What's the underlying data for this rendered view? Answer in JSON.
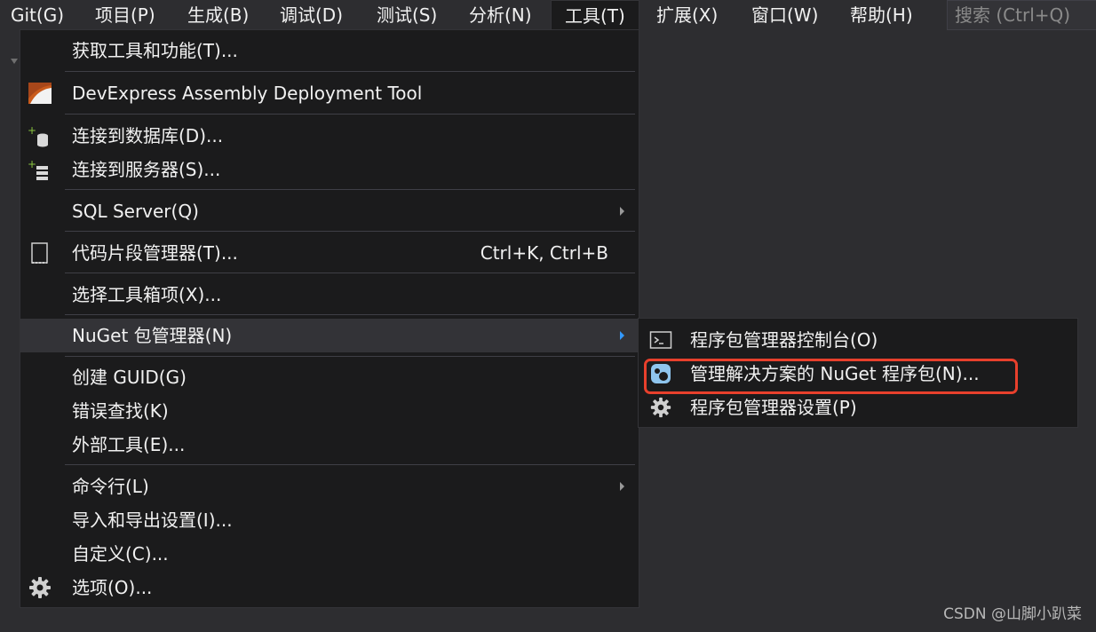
{
  "menubar": {
    "items": [
      "Git(G)",
      "项目(P)",
      "生成(B)",
      "调试(D)",
      "测试(S)",
      "分析(N)",
      "工具(T)",
      "扩展(X)",
      "窗口(W)",
      "帮助(H)"
    ],
    "active_item": "工具(T)",
    "search_placeholder": "搜索 (Ctrl+Q)"
  },
  "tools_menu": {
    "items": [
      {
        "label": "获取工具和功能(T)...",
        "icon": ""
      },
      {
        "label": "DevExpress Assembly Deployment Tool",
        "icon": "devexpress-icon"
      },
      {
        "label": "连接到数据库(D)...",
        "icon": "connect-database-icon"
      },
      {
        "label": "连接到服务器(S)...",
        "icon": "connect-server-icon"
      },
      {
        "label": "SQL Server(Q)",
        "icon": "",
        "submenu": true
      },
      {
        "label": "代码片段管理器(T)...",
        "icon": "code-snippet-icon",
        "shortcut": "Ctrl+K, Ctrl+B"
      },
      {
        "label": "选择工具箱项(X)...",
        "icon": ""
      },
      {
        "label": "NuGet 包管理器(N)",
        "icon": "",
        "submenu": true,
        "highlighted": true
      },
      {
        "label": "创建 GUID(G)",
        "icon": ""
      },
      {
        "label": "错误查找(K)",
        "icon": ""
      },
      {
        "label": "外部工具(E)...",
        "icon": ""
      },
      {
        "label": "命令行(L)",
        "icon": "",
        "submenu": true
      },
      {
        "label": "导入和导出设置(I)...",
        "icon": ""
      },
      {
        "label": "自定义(C)...",
        "icon": ""
      },
      {
        "label": "选项(O)...",
        "icon": "gear-icon"
      }
    ]
  },
  "nuget_submenu": {
    "items": [
      {
        "label": "程序包管理器控制台(O)",
        "icon": "console-icon"
      },
      {
        "label": "管理解决方案的 NuGet 程序包(N)...",
        "icon": "nuget-icon",
        "annotated": true
      },
      {
        "label": "程序包管理器设置(P)",
        "icon": "gear-icon"
      }
    ]
  },
  "colors": {
    "background": "#2d2d30",
    "menu_background": "#1b1b1c",
    "highlight": "#333337",
    "separator": "#3f3f46",
    "text": "#f1f1f1",
    "annotation_red": "#e8402c",
    "arrow_highlight": "#3399ff"
  },
  "watermark": "CSDN @山脚小趴菜"
}
